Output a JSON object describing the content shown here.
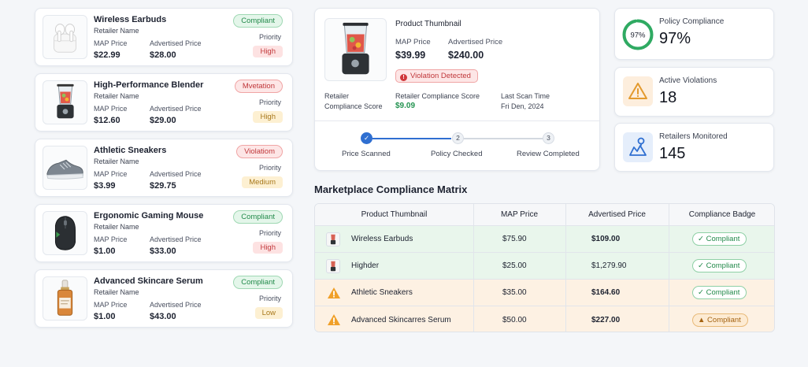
{
  "products": [
    {
      "name": "Wireless Earbuds",
      "retailer_label": "Retailer Name",
      "map_label": "MAP Price",
      "map_price": "$22.99",
      "adv_label": "Advertised Price",
      "adv_price": "$28.00",
      "status": "Compliant",
      "priority_label": "Priority",
      "priority": "High",
      "thumb": "earbuds-icon"
    },
    {
      "name": "High-Performance Blender",
      "retailer_label": "Retailer Name",
      "map_label": "MAP Price",
      "map_price": "$12.60",
      "adv_label": "Advertised Price",
      "adv_price": "$29.00",
      "status": "Mvetation",
      "priority_label": "Priority",
      "priority": "High",
      "thumb": "blender-icon"
    },
    {
      "name": "Athletic Sneakers",
      "retailer_label": "Retailer Name",
      "map_label": "MAP Price",
      "map_price": "$3.99",
      "adv_label": "Advertised Price",
      "adv_price": "$29.75",
      "status": "Violatiom",
      "priority_label": "Priority",
      "priority": "Medium",
      "thumb": "sneaker-icon"
    },
    {
      "name": "Ergonomic Gaming Mouse",
      "retailer_label": "Retailer Name",
      "map_label": "MAP Price",
      "map_price": "$1.00",
      "adv_label": "Advertised Price",
      "adv_price": "$33.00",
      "status": "Compliant",
      "priority_label": "Priority",
      "priority": "High",
      "thumb": "mouse-icon"
    },
    {
      "name": "Advanced Skincare Serum",
      "retailer_label": "Retailer Name",
      "map_label": "MAP Price",
      "map_price": "$1.00",
      "adv_label": "Advertised Price",
      "adv_price": "$43.00",
      "status": "Compliant",
      "priority_label": "Priority",
      "priority": "Low",
      "thumb": "serum-bottle-icon"
    }
  ],
  "detail": {
    "title": "Product Thumbnail",
    "map_label": "MAP Price",
    "map_price": "$39.99",
    "adv_label": "Advertised Price",
    "adv_price": "$240.00",
    "violation": "Violation Detected",
    "retailer_label": "Retailer",
    "compliance_score_label": "Compliance Score",
    "retailer_compliance_label": "Retailer Compliance Score",
    "retailer_compliance_value": "$9.09",
    "last_scan_label": "Last Scan Time",
    "last_scan_value": "Fri Den, 2024",
    "steps": [
      {
        "num": "✓",
        "label": "Price Scanned",
        "done": true
      },
      {
        "num": "2",
        "label": "Policy Checked",
        "done": false
      },
      {
        "num": "3",
        "label": "Review Completed",
        "done": false
      }
    ]
  },
  "kpis": {
    "policy": {
      "label": "Policy Compliance",
      "value": "97%",
      "ring_text": "97%",
      "percent": 97
    },
    "violations": {
      "label": "Active Violations",
      "value": "18",
      "icon": "warning-triangle-icon"
    },
    "retailers": {
      "label": "Retailers Monitored",
      "value": "145",
      "icon": "map-pin-icon"
    }
  },
  "matrix": {
    "title": "Marketplace Compliance Matrix",
    "columns": [
      "Product Thumbnail",
      "MAP Price",
      "Advertised Price",
      "Compliance Badge"
    ],
    "rows": [
      {
        "name": "Wireless Earbuds",
        "map": "$75.90",
        "adv": "$109.00",
        "badge": "Compliant",
        "tone": "green",
        "icon": "blender-icon"
      },
      {
        "name": "Highder",
        "map": "$25.00",
        "adv": "$1,279.90",
        "badge": "Compliant",
        "tone": "green",
        "icon": "blender-icon"
      },
      {
        "name": "Athletic Sneakers",
        "map": "$35.00",
        "adv": "$164.60",
        "badge": "Compliant",
        "tone": "orange",
        "icon": "warning-icon"
      },
      {
        "name": "Advanced Skincarres Serum",
        "map": "$50.00",
        "adv": "$227.00",
        "badge": "Compliant",
        "tone": "orange",
        "icon": "warning-icon"
      }
    ]
  },
  "colors": {
    "accent_blue": "#2f6fd1",
    "compliant_green": "#238a4b",
    "violation_red": "#c0373a",
    "warning_orange": "#e39a2e"
  }
}
